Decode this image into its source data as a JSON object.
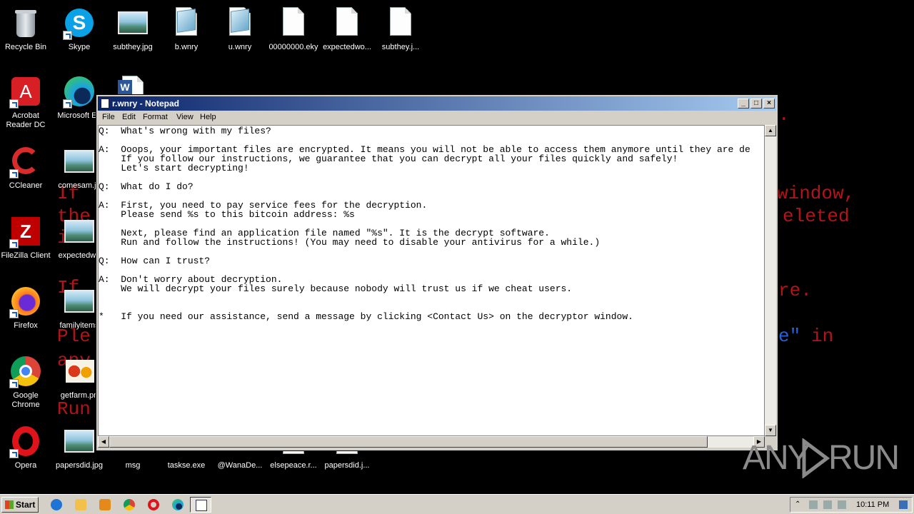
{
  "wallpaper": {
    "lines": [
      {
        "text": "If"
      },
      {
        "text": "the"
      },
      {
        "text": "i"
      },
      {
        "text": "If"
      },
      {
        "text": "Ple"
      },
      {
        "text": "any"
      },
      {
        "text": "Run"
      },
      {
        "text": "window,"
      },
      {
        "text": "eleted"
      },
      {
        "text": "re."
      },
      {
        "text": "e\""
      },
      {
        "text": "in"
      },
      {
        "text": "."
      }
    ]
  },
  "desktop": {
    "icons": [
      {
        "label": "Recycle Bin",
        "icon": "recycle-bin-icon"
      },
      {
        "label": "Skype",
        "icon": "skype-icon"
      },
      {
        "label": "subthey.jpg",
        "icon": "image-file-icon"
      },
      {
        "label": "b.wnry",
        "icon": "wnry-file-icon"
      },
      {
        "label": "u.wnry",
        "icon": "wnry-file-icon"
      },
      {
        "label": "00000000.eky",
        "icon": "blank-file-icon"
      },
      {
        "label": "expectedwo...",
        "icon": "blank-file-icon"
      },
      {
        "label": "subthey.j...",
        "icon": "blank-file-icon"
      },
      {
        "label": "Acrobat Reader DC",
        "icon": "acrobat-icon"
      },
      {
        "label": "Microsoft Ed",
        "icon": "edge-icon"
      },
      {
        "label": "CCleaner",
        "icon": "ccleaner-icon"
      },
      {
        "label": "comesam.jp",
        "icon": "image-file-icon"
      },
      {
        "label": "FileZilla Client",
        "icon": "filezilla-icon"
      },
      {
        "label": "expectedwo",
        "icon": "image-file-icon"
      },
      {
        "label": "Firefox",
        "icon": "firefox-icon"
      },
      {
        "label": "familyitems",
        "icon": "image-file-icon"
      },
      {
        "label": "Google Chrome",
        "icon": "chrome-icon"
      },
      {
        "label": "getfarm.pn",
        "icon": "image-file-icon"
      },
      {
        "label": "Opera",
        "icon": "opera-icon"
      },
      {
        "label": "papersdid.jpg",
        "icon": "image-file-icon"
      },
      {
        "label": "msg",
        "icon": "folder-icon"
      },
      {
        "label": "taskse.exe",
        "icon": "exe-icon"
      },
      {
        "label": "@WanaDe...",
        "icon": "exe-icon"
      },
      {
        "label": "elsepeace.r...",
        "icon": "blank-file-icon"
      },
      {
        "label": "papersdid.j...",
        "icon": "blank-file-icon"
      }
    ]
  },
  "notepad": {
    "title": "r.wnry - Notepad",
    "menu": [
      "File",
      "Edit",
      "Format",
      "View",
      "Help"
    ],
    "buttons": {
      "minimize": "_",
      "maximize": "□",
      "close": "×"
    },
    "content": "Q:  What's wrong with my files?\n\nA:  Ooops, your important files are encrypted. It means you will not be able to access them anymore until they are de\n    If you follow our instructions, we guarantee that you can decrypt all your files quickly and safely!\n    Let's start decrypting!\n\nQ:  What do I do?\n\nA:  First, you need to pay service fees for the decryption.\n    Please send %s to this bitcoin address: %s\n\n    Next, please find an application file named \"%s\". It is the decrypt software.\n    Run and follow the instructions! (You may need to disable your antivirus for a while.)\n\nQ:  How can I trust?\n\nA:  Don't worry about decryption.\n    We will decrypt your files surely because nobody will trust us if we cheat users.\n\n\n*   If you need our assistance, send a message by clicking <Contact Us> on the decryptor window."
  },
  "watermark": {
    "left": "ANY",
    "right": "RUN"
  },
  "taskbar": {
    "start_label": "Start",
    "quick_launch": [
      "ie-icon",
      "explorer-icon",
      "media-player-icon",
      "chrome-icon",
      "opera-icon",
      "edge-icon"
    ],
    "clock": "10:11 PM"
  }
}
